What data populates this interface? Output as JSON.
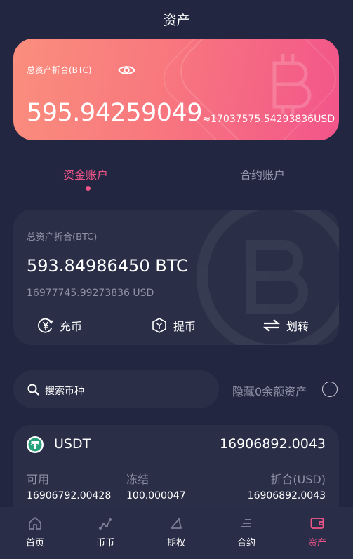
{
  "header": {
    "title": "资产"
  },
  "summary": {
    "label": "总资产折合(BTC)",
    "amount": "595.94259049",
    "usd": "≈17037575.54293836USD"
  },
  "tabs": [
    {
      "label": "资金账户",
      "active": true
    },
    {
      "label": "合约账户",
      "active": false
    }
  ],
  "account": {
    "label": "总资产折合(BTC)",
    "btc": "593.84986450 BTC",
    "usd": "16977745.99273836 USD",
    "actions": [
      {
        "label": "充币",
        "icon": "yen-deposit-icon"
      },
      {
        "label": "提币",
        "icon": "hexagon-withdraw-icon"
      },
      {
        "label": "划转",
        "icon": "transfer-arrows-icon"
      }
    ]
  },
  "search": {
    "placeholder": "搜索币种"
  },
  "hide_zero": {
    "label": "隐藏0余额资产"
  },
  "coins": [
    {
      "symbol": "USDT",
      "total": "16906892.0043",
      "available_label": "可用",
      "available": "16906792.00428",
      "frozen_label": "冻结",
      "frozen": "100.000047",
      "equiv_label": "折合(USD)",
      "equiv": "16906892.0043"
    }
  ],
  "nav": [
    {
      "label": "首页",
      "icon": "home-icon"
    },
    {
      "label": "币币",
      "icon": "coin-trade-icon"
    },
    {
      "label": "期权",
      "icon": "options-icon"
    },
    {
      "label": "合约",
      "icon": "contract-icon"
    },
    {
      "label": "资产",
      "icon": "wallet-icon",
      "active": true
    }
  ],
  "colors": {
    "accent": "#f0558a",
    "background": "#222640",
    "card": "#2a2e47",
    "muted": "#8e91a6"
  }
}
